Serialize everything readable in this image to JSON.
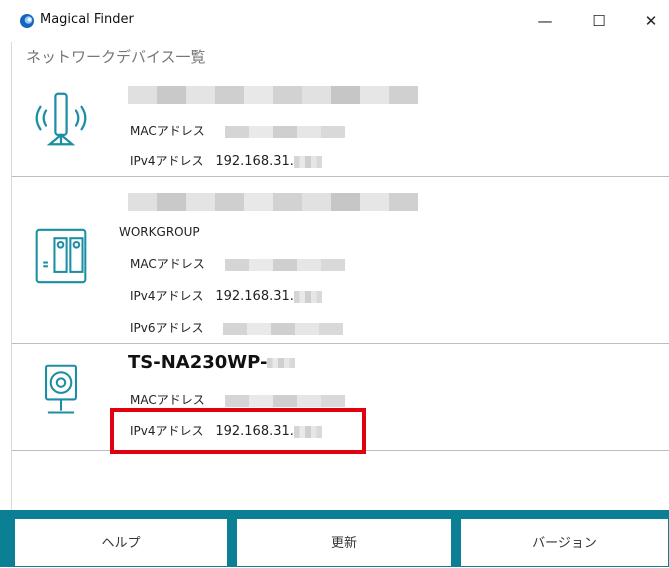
{
  "window": {
    "title": "Magical Finder",
    "minimize": "—",
    "maximize": "☐",
    "close": "✕"
  },
  "header": {
    "subtitle": "ネットワークデバイス一覧"
  },
  "devices": [
    {
      "icon": "wireless-router-icon",
      "rows": [
        {
          "label": "MACアドレス",
          "value": ""
        },
        {
          "label": "IPv4アドレス",
          "value": "192.168.31."
        }
      ]
    },
    {
      "icon": "nas-icon",
      "workgroup": "WORKGROUP",
      "rows": [
        {
          "label": "MACアドレス",
          "value": ""
        },
        {
          "label": "IPv4アドレス",
          "value": "192.168.31."
        },
        {
          "label": "IPv6アドレス",
          "value": ""
        }
      ]
    },
    {
      "icon": "camera-icon",
      "name": "TS-NA230WP-",
      "rows": [
        {
          "label": "MACアドレス",
          "value": ""
        },
        {
          "label": "IPv4アドレス",
          "value": "192.168.31."
        }
      ]
    }
  ],
  "footer": {
    "help": "ヘルプ",
    "refresh": "更新",
    "version": "バージョン"
  },
  "colors": {
    "accent": "#0b7f93",
    "highlight": "#e1000f"
  }
}
